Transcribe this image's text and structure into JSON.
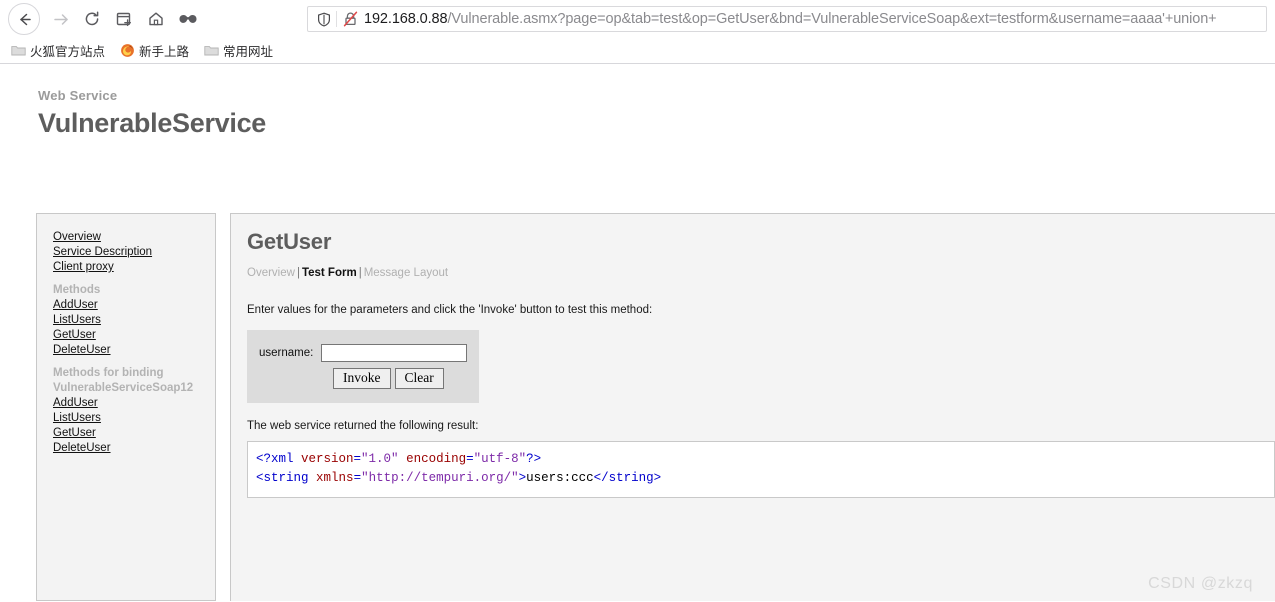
{
  "browser": {
    "toolbar_buttons": [
      {
        "name": "back-button",
        "icon": "arrow-left-icon",
        "state": "enabled"
      },
      {
        "name": "forward-button",
        "icon": "arrow-right-icon",
        "state": "disabled"
      },
      {
        "name": "reload-button",
        "icon": "reload-icon",
        "state": "enabled"
      },
      {
        "name": "new-container-tab-button",
        "icon": "new-container-tab-icon",
        "state": "enabled"
      },
      {
        "name": "home-button",
        "icon": "home-icon",
        "state": "enabled"
      },
      {
        "name": "private-mask-button",
        "icon": "mask-icon",
        "state": "enabled"
      }
    ],
    "url_bar": {
      "shield_icon": "shield-icon",
      "connection_icon": "lock-crossed-out-icon",
      "host": "192.168.0.88",
      "path_query": "/Vulnerable.asmx?page=op&tab=test&op=GetUser&bnd=VulnerableServiceSoap&ext=testform&username=aaaa'+union+",
      "full_url": "192.168.0.88/Vulnerable.asmx?page=op&tab=test&op=GetUser&bnd=VulnerableServiceSoap&ext=testform&username=aaaa'+union+"
    },
    "bookmarks": [
      {
        "label": "火狐官方站点",
        "icon": "folder-icon"
      },
      {
        "label": "新手上路",
        "icon": "firefox-icon"
      },
      {
        "label": "常用网址",
        "icon": "folder-icon"
      }
    ]
  },
  "header": {
    "eyebrow": "Web Service",
    "title": "VulnerableService"
  },
  "sidebar": {
    "top_links": [
      {
        "label": "Overview"
      },
      {
        "label": "Service Description"
      },
      {
        "label": "Client proxy"
      }
    ],
    "methods_group": {
      "title": "Methods",
      "items": [
        {
          "label": "AddUser"
        },
        {
          "label": "ListUsers"
        },
        {
          "label": "GetUser"
        },
        {
          "label": "DeleteUser"
        }
      ]
    },
    "binding_group": {
      "title_line1": "Methods for binding",
      "title_line2": "VulnerableServiceSoap12",
      "items": [
        {
          "label": "AddUser"
        },
        {
          "label": "ListUsers"
        },
        {
          "label": "GetUser"
        },
        {
          "label": "DeleteUser"
        }
      ]
    }
  },
  "main": {
    "method_title": "GetUser",
    "tabs": [
      {
        "label": "Overview",
        "active": false
      },
      {
        "label": "Test Form",
        "active": true
      },
      {
        "label": "Message Layout",
        "active": false
      }
    ],
    "tab_separator": "|",
    "instructions": "Enter values for the parameters and click the 'Invoke' button to test this method:",
    "form": {
      "param_label": "username:",
      "param_value": "",
      "param_placeholder": "",
      "invoke_label": "Invoke",
      "clear_label": "Clear"
    },
    "result_label": "The web service returned the following result:",
    "xml_result": {
      "line1": {
        "open": "<?xml ",
        "attr1_name": "version",
        "attr1_eq": "=",
        "attr1_value": "\"1.0\"",
        "space": " ",
        "attr2_name": "encoding",
        "attr2_eq": "=",
        "attr2_value": "\"utf-8\"",
        "close": "?>"
      },
      "line2": {
        "open_bracket": "<",
        "tag_name": "string",
        "space": " ",
        "attr_name": "xmlns",
        "attr_eq": "=",
        "attr_value": "\"http://tempuri.org/\"",
        "gt": ">",
        "text": "users:ccc",
        "close_bracket": "</",
        "close_tag_name": "string",
        "close_gt": ">"
      },
      "raw": "<?xml version=\"1.0\" encoding=\"utf-8\"?>\n<string xmlns=\"http://tempuri.org/\">users:ccc</string>"
    }
  },
  "watermark": {
    "text": "CSDN @zkzq"
  },
  "colors": {
    "xml_punct": "#0000cc",
    "xml_attr": "#990000",
    "xml_value": "#7d2aa8",
    "panel_bg": "#f4f4f4",
    "form_bg": "#dcdcdc"
  }
}
